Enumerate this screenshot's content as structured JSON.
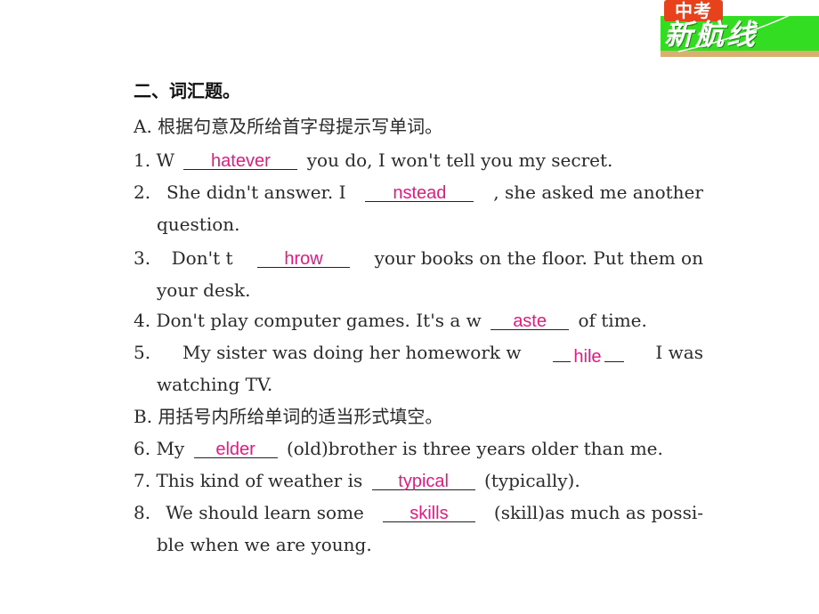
{
  "logo": {
    "badge_text": "中考",
    "main_text": "新航线",
    "colors": {
      "badge": "#e8421c",
      "band": "#33dd22",
      "strip": "#d9b070"
    }
  },
  "section": {
    "title": "二、词汇题。",
    "part_a": {
      "instruction": "A. 根据句意及所给首字母提示写单词。",
      "items": [
        {
          "num": "1.",
          "before": "W",
          "answer": "hatever",
          "after": "you do, I won't tell you my secret."
        },
        {
          "num": "2.",
          "before": "She didn't answer. I",
          "answer": "nstead",
          "after": ", she asked me another",
          "continuation": "question."
        },
        {
          "num": "3.",
          "before": "Don't t",
          "answer": "hrow",
          "after": "your books on the floor. Put them on",
          "continuation": "your desk."
        },
        {
          "num": "4.",
          "before": "Don't play computer games. It's a w",
          "answer": "aste",
          "after": "of time."
        },
        {
          "num": "5.",
          "before": "My sister was doing her homework w",
          "answer": "hile",
          "after": "I was",
          "continuation": "watching TV."
        }
      ]
    },
    "part_b": {
      "instruction": "B. 用括号内所给单词的适当形式填空。",
      "items": [
        {
          "num": "6.",
          "before": "My",
          "answer": "elder",
          "after": "(old)brother is three years older than me."
        },
        {
          "num": "7.",
          "before": "This kind of weather is",
          "answer": "typical",
          "after": "(typically)."
        },
        {
          "num": "8.",
          "before": "We should learn some",
          "answer": "skills",
          "after": "(skill)as much as possi-",
          "continuation": "ble when we are young."
        }
      ]
    },
    "answer_color": "#e5197f"
  }
}
